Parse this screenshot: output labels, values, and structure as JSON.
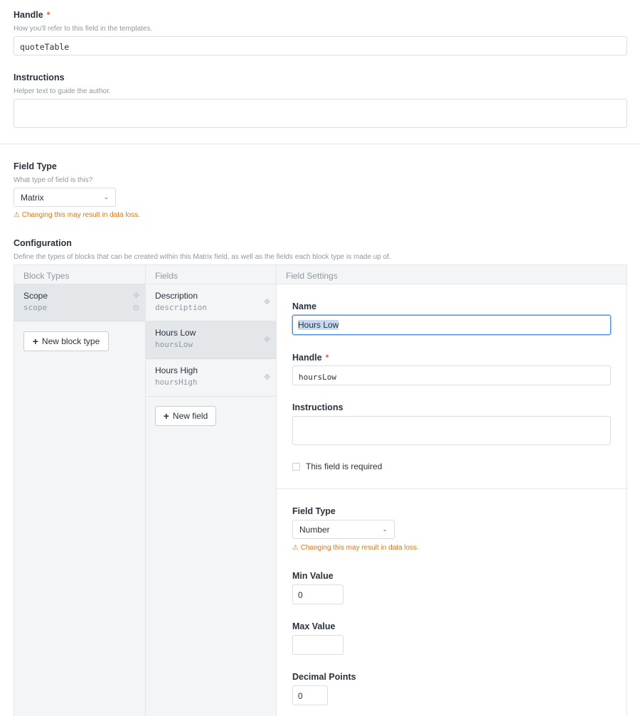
{
  "handle": {
    "label": "Handle",
    "required_mark": "*",
    "hint": "How you'll refer to this field in the templates.",
    "value": "quoteTable"
  },
  "instructions": {
    "label": "Instructions",
    "hint": "Helper text to guide the author.",
    "value": ""
  },
  "field_type": {
    "label": "Field Type",
    "hint": "What type of field is this?",
    "selected": "Matrix",
    "warning": "Changing this may result in data loss."
  },
  "configuration": {
    "label": "Configuration",
    "hint": "Define the types of blocks that can be created within this Matrix field, as well as the fields each block type is made up of.",
    "columns": {
      "block_types": "Block Types",
      "fields": "Fields",
      "field_settings": "Field Settings"
    },
    "block_types": [
      {
        "name": "Scope",
        "handle": "scope"
      }
    ],
    "new_block_type_label": "New block type",
    "fields": [
      {
        "name": "Description",
        "handle": "description"
      },
      {
        "name": "Hours Low",
        "handle": "hoursLow"
      },
      {
        "name": "Hours High",
        "handle": "hoursHigh"
      }
    ],
    "new_field_label": "New field"
  },
  "settings": {
    "name_label": "Name",
    "name_value": "Hours Low",
    "handle_label": "Handle",
    "handle_required_mark": "*",
    "handle_value": "hoursLow",
    "instructions_label": "Instructions",
    "instructions_value": "",
    "required_checkbox_label": "This field is required",
    "required_checked": false,
    "field_type_label": "Field Type",
    "field_type_selected": "Number",
    "field_type_warning": "Changing this may result in data loss.",
    "min_label": "Min Value",
    "min_value": "0",
    "max_label": "Max Value",
    "max_value": "",
    "decimals_label": "Decimal Points",
    "decimals_value": "0"
  },
  "icons": {
    "warning": "warning-triangle-icon",
    "move": "move-icon",
    "gear": "gear-icon",
    "plus": "plus-icon",
    "chevron": "chevron-down-icon"
  },
  "colors": {
    "required": "#da5a47",
    "warning": "#e0771a",
    "focus": "#4d90dd",
    "selection": "#c8daf0"
  }
}
